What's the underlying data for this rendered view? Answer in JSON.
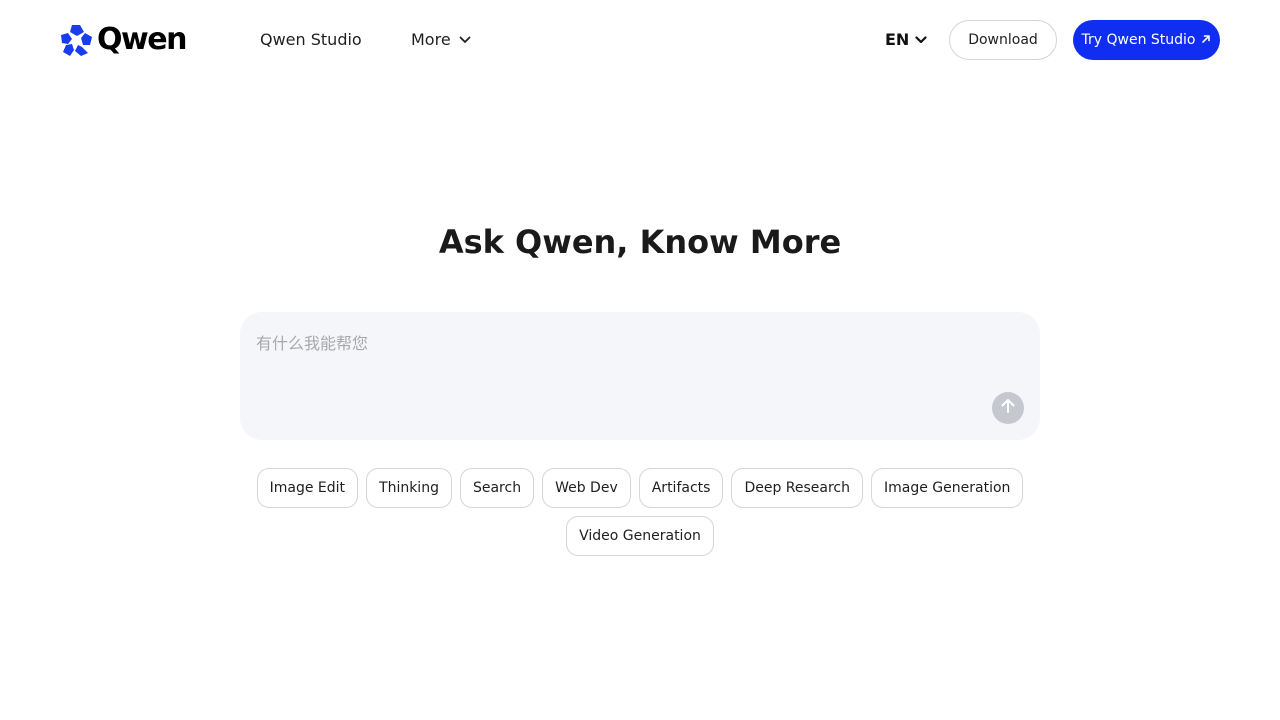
{
  "header": {
    "logo_text": "Qwen",
    "nav": {
      "studio_label": "Qwen Studio",
      "more_label": "More"
    },
    "language": "EN",
    "download_label": "Download",
    "try_label": "Try Qwen Studio"
  },
  "hero": {
    "title": "Ask Qwen, Know More",
    "input_placeholder": "有什么我能帮您"
  },
  "chips": [
    "Image Edit",
    "Thinking",
    "Search",
    "Web Dev",
    "Artifacts",
    "Deep Research",
    "Image Generation",
    "Video Generation"
  ],
  "colors": {
    "accent": "#0f2ef2",
    "logo_mark": "#1a3cf0",
    "input_bg": "#f5f6fa",
    "send_disabled": "#c6c8cf"
  },
  "icons": {
    "logo": "qwen-star-logo-icon",
    "dropdown": "chevron-down-icon",
    "external": "arrow-up-right-icon",
    "send": "arrow-up-icon"
  }
}
